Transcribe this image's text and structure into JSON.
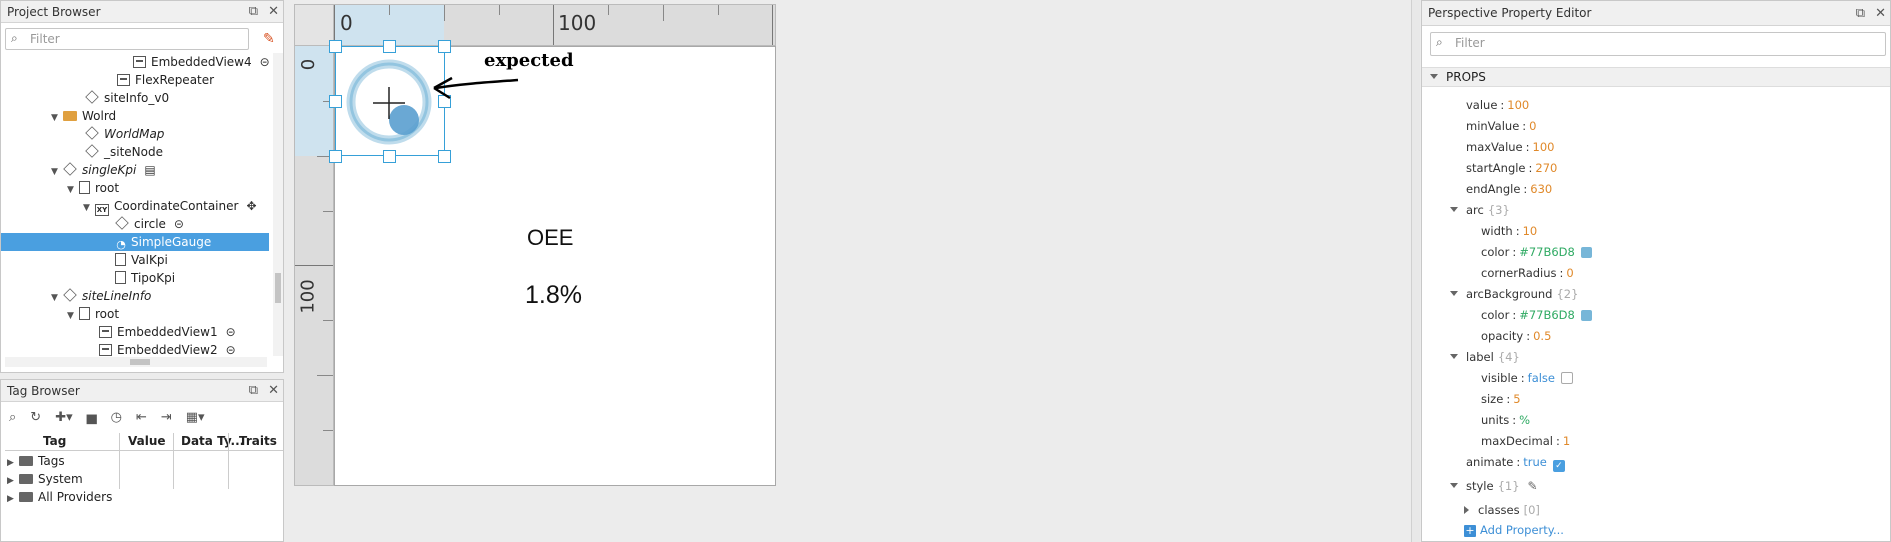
{
  "project_browser": {
    "title": "Project Browser",
    "filter_placeholder": "Filter",
    "items": [
      {
        "label": "EmbeddedView4"
      },
      {
        "label": "FlexRepeater"
      },
      {
        "label": "siteInfo_v0"
      },
      {
        "label": "Wolrd"
      },
      {
        "label": "WorldMap"
      },
      {
        "label": "_siteNode"
      },
      {
        "label": "singleKpi"
      },
      {
        "label": "root"
      },
      {
        "label": "CoordinateContainer"
      },
      {
        "label": "circle"
      },
      {
        "label": "SimpleGauge"
      },
      {
        "label": "ValKpi"
      },
      {
        "label": "TipoKpi"
      },
      {
        "label": "siteLineInfo"
      },
      {
        "label": "root"
      },
      {
        "label": "EmbeddedView1"
      },
      {
        "label": "EmbeddedView2"
      }
    ]
  },
  "tag_browser": {
    "title": "Tag Browser",
    "columns": [
      "Tag",
      "Value",
      "Data Ty...",
      "Traits"
    ],
    "rows": [
      {
        "label": "Tags"
      },
      {
        "label": "System"
      },
      {
        "label": "All Providers"
      }
    ]
  },
  "designer": {
    "ruler_top": [
      "0",
      "100"
    ],
    "ruler_left": [
      "0",
      "100"
    ],
    "annotation": "expected",
    "canvas_title": "OEE",
    "canvas_value": "1.8%",
    "gauge_color": "#77B6D8"
  },
  "property_editor": {
    "title": "Perspective Property Editor",
    "filter_placeholder": "Filter",
    "section": "PROPS",
    "props": [
      {
        "key": "value",
        "val": "100",
        "type": "num"
      },
      {
        "key": "minValue",
        "val": "0",
        "type": "num"
      },
      {
        "key": "maxValue",
        "val": "100",
        "type": "num"
      },
      {
        "key": "startAngle",
        "val": "270",
        "type": "num"
      },
      {
        "key": "endAngle",
        "val": "630",
        "type": "num"
      },
      {
        "key": "arc",
        "val": "{3}",
        "type": "obj"
      },
      {
        "key": "width",
        "val": "10",
        "type": "num"
      },
      {
        "key": "color",
        "val": "#77B6D8",
        "type": "str"
      },
      {
        "key": "cornerRadius",
        "val": "0",
        "type": "num"
      },
      {
        "key": "arcBackground",
        "val": "{2}",
        "type": "obj"
      },
      {
        "key": "color",
        "val": "#77B6D8",
        "type": "str"
      },
      {
        "key": "opacity",
        "val": "0.5",
        "type": "num"
      },
      {
        "key": "label",
        "val": "{4}",
        "type": "obj"
      },
      {
        "key": "visible",
        "val": "false",
        "type": "bool"
      },
      {
        "key": "size",
        "val": "5",
        "type": "num"
      },
      {
        "key": "units",
        "val": "%",
        "type": "str"
      },
      {
        "key": "maxDecimal",
        "val": "1",
        "type": "num"
      },
      {
        "key": "animate",
        "val": "true",
        "type": "bool"
      },
      {
        "key": "style",
        "val": "{1}",
        "type": "obj"
      },
      {
        "key": "classes",
        "val": "[0]",
        "type": "arr"
      }
    ],
    "add_property": "Add Property..."
  }
}
